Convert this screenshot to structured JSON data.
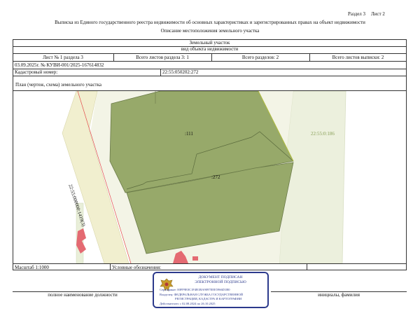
{
  "header": {
    "section_label": "Раздел 3",
    "sheet_label": "Лист 2",
    "title": "Выписка из Единого государственного реестра недвижимости об основных характеристиках и зарегистрированных правах на объект недвижимости",
    "subtitle": "Описание местоположения земельного участка"
  },
  "object": {
    "type": "Земельный участок",
    "type_caption": "вид объекта недвижимости"
  },
  "sheet_row": {
    "sheet_of_section": "Лист № 1 раздела 3",
    "section_sheets_total": "Всего листов раздела 3: 1",
    "sections_total": "Всего разделов: 2",
    "extract_sheets_total": "Всего листов выписки: 2"
  },
  "doc": {
    "date_number": "03.09.2025г. № КУВИ-001/2025-167614832",
    "cadastral_label": "Кадастровый номер:",
    "cadastral_value": "22:55:050202:272"
  },
  "plan": {
    "caption": "План (чертеж, схема) земельного участка",
    "labels": {
      "neighbor_111": ":111",
      "parcel_272": ":272",
      "block_east": "22:55:0:186",
      "street": "22:55:000000:1419(3)"
    }
  },
  "footer": {
    "scale": "Масштаб 1:1000",
    "legend": "Условные обозначения:",
    "position_caption": "полное наименование должности",
    "name_caption": "инициалы, фамилия"
  },
  "stamp": {
    "line1": "ДОКУМЕНТ ПОДПИСАН",
    "line2": "ЭЛЕКТРОННОЙ ПОДПИСЬЮ",
    "cert": "Сертификат: 00FF9E0C1F4B1BA9097EEE5966D1B0",
    "owner1": "Владелец: ФЕДЕРАЛЬНАЯ СЛУЖБА ГОСУДАРСТВЕННОЙ",
    "owner2": "РЕГИСТРАЦИИ, КАДАСТРА И КАРТОГРАФИИ",
    "valid": "Действителен: с 02.08.2024 по 26.10.2025"
  },
  "colors": {
    "parcel_fill": "#97a96a",
    "road_fill": "#f1efcf",
    "block_fill": "#ecf0dd",
    "boundary_red": "#e34b4b",
    "stamp_border": "#2c3a8c"
  }
}
